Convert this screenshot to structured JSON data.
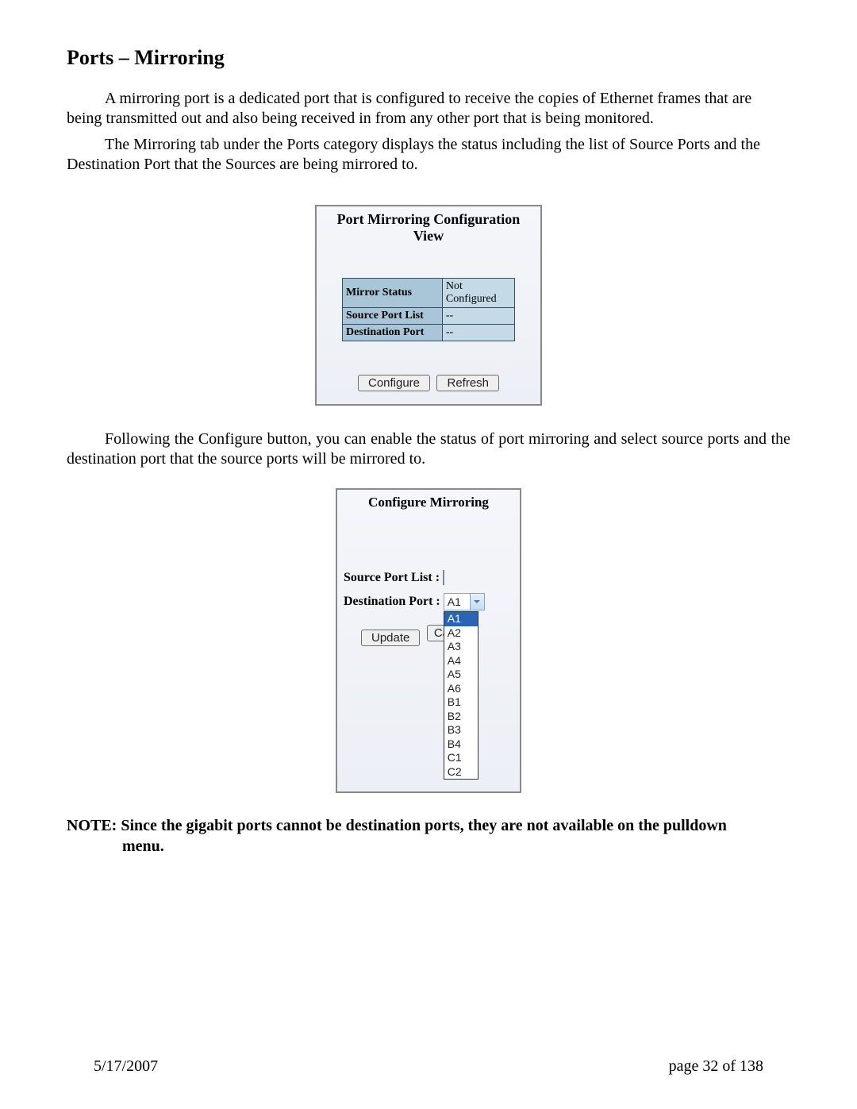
{
  "heading": "Ports – Mirroring",
  "para1a": "A mirroring port is a dedicated port that is configured to receive the copies of Ethernet frames that are being transmitted out and also being received in from any other port that is being monitored.",
  "para1b": "The Mirroring tab under the Ports category displays the status including the list of Source Ports and the Destination Port that the Sources are being mirrored to.",
  "panel1": {
    "title": "Port Mirroring Configuration View",
    "rows": {
      "mirror_status_label": "Mirror Status",
      "mirror_status_value": "Not Configured",
      "source_list_label": "Source Port List",
      "source_list_value": "--",
      "dest_port_label": "Destination Port",
      "dest_port_value": "--"
    },
    "buttons": {
      "configure": "Configure",
      "refresh": "Refresh"
    }
  },
  "para2": "Following the Configure button, you can enable the status of port mirroring and select source ports and the destination port that the source ports will be mirrored to.",
  "panel2": {
    "title": "Configure Mirroring",
    "source_label": "Source Port List :",
    "dest_label": "Destination Port :",
    "selected": "A1",
    "options": [
      "A1",
      "A2",
      "A3",
      "A4",
      "A5",
      "A6",
      "B1",
      "B2",
      "B3",
      "B4",
      "C1",
      "C2"
    ],
    "buttons": {
      "update": "Update",
      "cancel": "Cancel"
    }
  },
  "note_full": "NOTE: Since the gigabit ports cannot be destination ports, they are not available on the pulldown",
  "note_line2": "menu.",
  "footer": {
    "date": "5/17/2007",
    "page": "page 32 of 138"
  }
}
